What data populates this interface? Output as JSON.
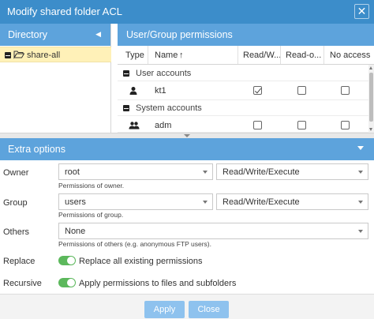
{
  "window": {
    "title": "Modify shared folder ACL",
    "close_glyph": "✕"
  },
  "directory": {
    "header": "Directory",
    "collapse_glyph": "◀",
    "items": [
      {
        "label": "share-all",
        "icon": "folder-open-icon",
        "selected": true
      }
    ]
  },
  "permissions": {
    "header": "User/Group permissions",
    "columns": {
      "type": "Type",
      "name": "Name",
      "sort_glyph": "↑",
      "read_write": "Read/W...",
      "read_only": "Read-o...",
      "no_access": "No access"
    },
    "groups": [
      {
        "label": "User accounts",
        "rows": [
          {
            "name": "kt1",
            "icon": "user-icon",
            "read_write": true,
            "read_only": false,
            "no_access": false
          }
        ]
      },
      {
        "label": "System accounts",
        "rows": [
          {
            "name": "adm",
            "icon": "users-icon",
            "read_write": false,
            "read_only": false,
            "no_access": false
          }
        ]
      }
    ]
  },
  "extra": {
    "header": "Extra options",
    "owner": {
      "label": "Owner",
      "value": "root",
      "permission": "Read/Write/Execute",
      "hint": "Permissions of owner."
    },
    "group": {
      "label": "Group",
      "value": "users",
      "permission": "Read/Write/Execute",
      "hint": "Permissions of group."
    },
    "others": {
      "label": "Others",
      "value": "None",
      "hint": "Permissions of others (e.g. anonymous FTP users)."
    },
    "replace": {
      "label": "Replace",
      "toggle_label": "Replace all existing permissions",
      "on": true
    },
    "recursive": {
      "label": "Recursive",
      "toggle_label": "Apply permissions to files and subfolders",
      "on": true
    }
  },
  "buttons": {
    "apply": "Apply",
    "close": "Close"
  },
  "colors": {
    "titlebar": "#3c8dca",
    "panel_header": "#5da3dc",
    "selection": "#fff1b8",
    "toggle_on": "#5cb85c",
    "button": "#8ec2ee"
  }
}
